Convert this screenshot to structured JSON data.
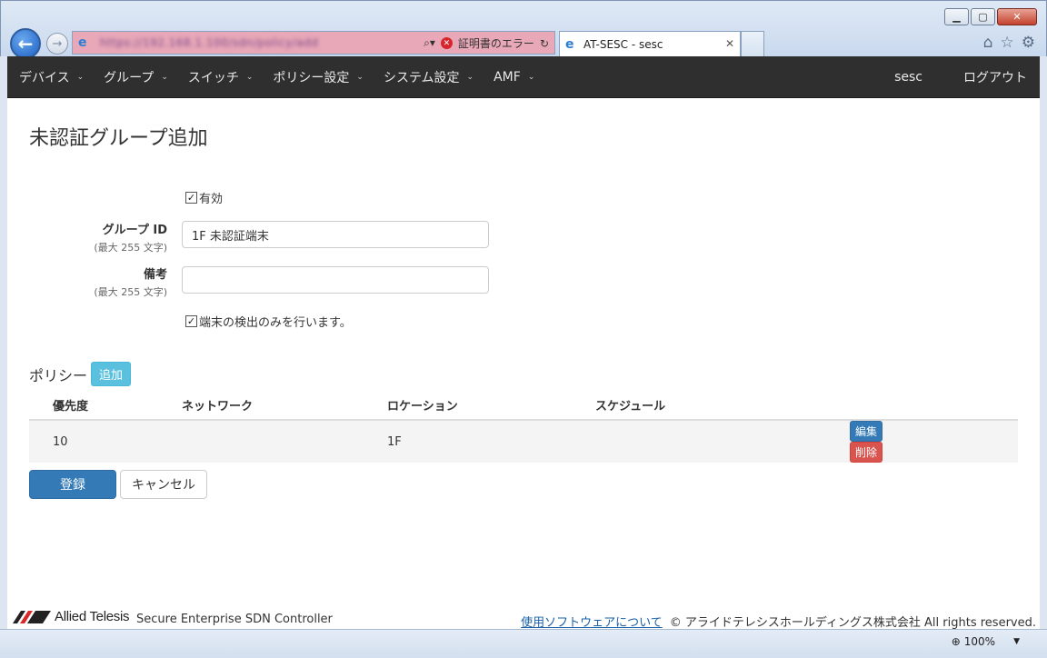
{
  "browser": {
    "url": "https://192.168.1.100/sdn/policy/add",
    "cert_error": "証明書のエラー",
    "tab_title": "AT-SESC - sesc",
    "zoom": "100%"
  },
  "nav": {
    "items": [
      "デバイス",
      "グループ",
      "スイッチ",
      "ポリシー設定",
      "システム設定",
      "AMF"
    ],
    "user": "sesc",
    "logout": "ログアウト"
  },
  "page": {
    "title": "未認証グループ追加",
    "enabled_label": "有効",
    "group_id_label": "グループ ID",
    "group_id_hint": "(最大 255 文字)",
    "group_id_value": "1F 未認証端末",
    "note_label": "備考",
    "note_hint": "(最大 255 文字)",
    "note_value": "",
    "detect_only_label": "端末の検出のみを行います。"
  },
  "policy": {
    "heading": "ポリシー",
    "add_label": "追加",
    "columns": [
      "優先度",
      "ネットワーク",
      "ロケーション",
      "スケジュール"
    ],
    "rows": [
      {
        "priority": "10",
        "network": "",
        "location": "1F",
        "schedule": "",
        "edit": "編集",
        "delete": "削除"
      }
    ]
  },
  "actions": {
    "submit": "登録",
    "cancel": "キャンセル"
  },
  "footer": {
    "brand": "Allied Telesis",
    "product": "Secure Enterprise SDN Controller",
    "software_link": "使用ソフトウェアについて",
    "copyright": "© アライドテレシスホールディングス株式会社 All rights reserved."
  }
}
